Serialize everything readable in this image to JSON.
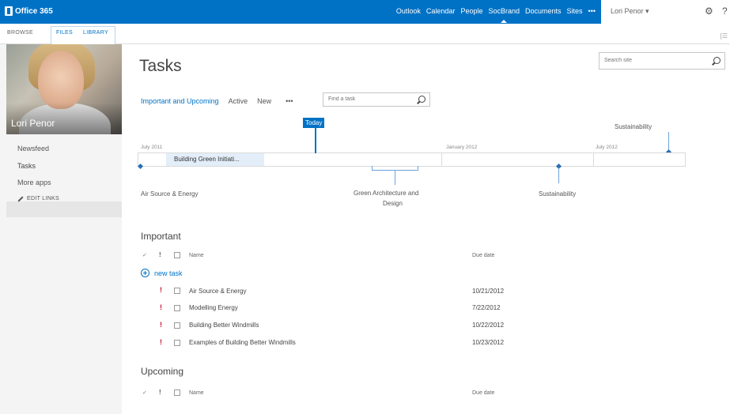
{
  "suite": {
    "brand": "Office 365",
    "nav": [
      "Outlook",
      "Calendar",
      "People",
      "SocBrand",
      "Documents",
      "Sites",
      "•••"
    ],
    "active_index": 3,
    "user": "Lori Penor ▾",
    "gear": "⚙",
    "help": "?"
  },
  "ribbon": {
    "tabs": [
      "BROWSE",
      "FILES",
      "LIBRARY"
    ],
    "right_glyph": "[☰"
  },
  "profile": {
    "name": "Lori Penor"
  },
  "quicklaunch": {
    "items": [
      "Newsfeed",
      "Tasks",
      "More apps"
    ],
    "edit_links": "EDIT LINKS"
  },
  "page": {
    "title": "Tasks"
  },
  "site_search": {
    "placeholder": "Search site"
  },
  "views": {
    "items": [
      "Important and Upcoming",
      "Active",
      "New",
      "•••"
    ],
    "search_placeholder": "Find a task"
  },
  "timeline": {
    "months": [
      "July 2011",
      "January 2012",
      "July 2012"
    ],
    "today": "Today",
    "bar_label": "Building Green Initiati...",
    "labels": {
      "air": "Air Source & Energy",
      "green": "Green Architecture and",
      "green2": "Design",
      "sust_low": "Sustainability",
      "sust_high": "Sustainability"
    }
  },
  "important": {
    "title": "Important",
    "col_name": "Name",
    "col_due": "Due date",
    "check": "✓",
    "excl": "!",
    "new_task": "new task",
    "rows": [
      {
        "name": "Air Source & Energy",
        "due": "10/21/2012"
      },
      {
        "name": "Modelling Energy",
        "due": "7/22/2012"
      },
      {
        "name": "Building Better Windmills",
        "due": "10/22/2012"
      },
      {
        "name": "Examples of Building Better Windmills",
        "due": "10/23/2012"
      }
    ]
  },
  "upcoming": {
    "title": "Upcoming",
    "col_name": "Name",
    "col_due": "Due date",
    "check": "✓",
    "excl": "!"
  }
}
